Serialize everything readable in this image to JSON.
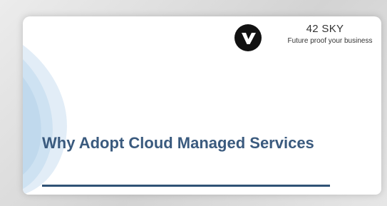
{
  "brand": {
    "name": "42 SKY",
    "tagline": "Future proof your business",
    "logo_icon": "v-monogram-icon"
  },
  "slide": {
    "title": "Why Adopt Cloud Managed Services"
  },
  "colors": {
    "title": "#3a5a7e",
    "underline": "#2f5275",
    "logo_background": "#111111",
    "watermark": "#c9dff0",
    "frame": "#d9d9d9"
  }
}
